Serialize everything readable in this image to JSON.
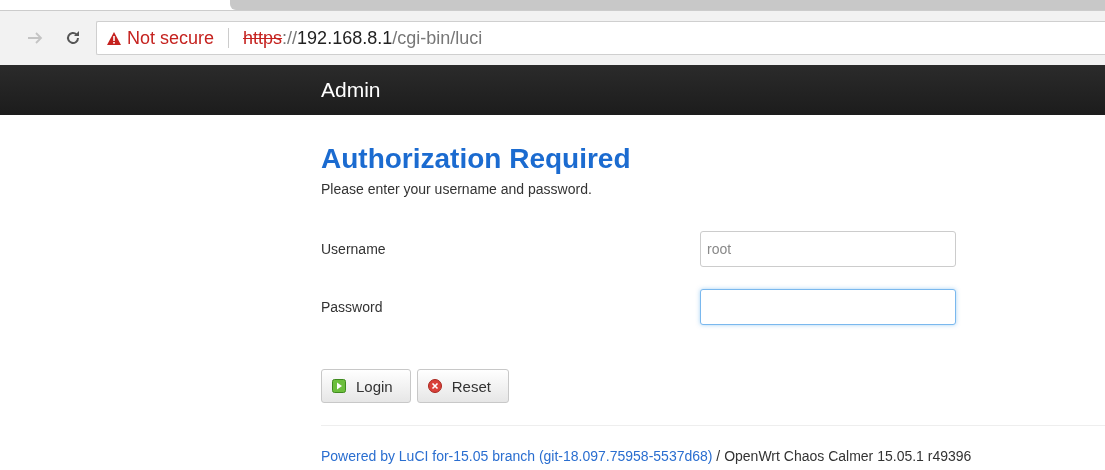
{
  "browser": {
    "security_label": "Not secure",
    "insecure": true,
    "url": {
      "scheme": "https",
      "separator": "://",
      "host": "192.168.8.1",
      "path": "/cgi-bin/luci"
    }
  },
  "header": {
    "title": "Admin"
  },
  "login": {
    "title": "Authorization Required",
    "intro": "Please enter your username and password.",
    "fields": [
      {
        "label": "Username",
        "value": "root",
        "focused": false
      },
      {
        "label": "Password",
        "focused": true
      }
    ],
    "buttons": [
      {
        "label": "Login",
        "kind": "login"
      },
      {
        "label": "Reset",
        "kind": "reset"
      }
    ]
  },
  "footer": {
    "link": "Powered by LuCI for-15.05 branch (git-18.097.75958-5537d68)",
    "text": " / OpenWrt Chaos Calmer 15.05.1 r49396"
  }
}
